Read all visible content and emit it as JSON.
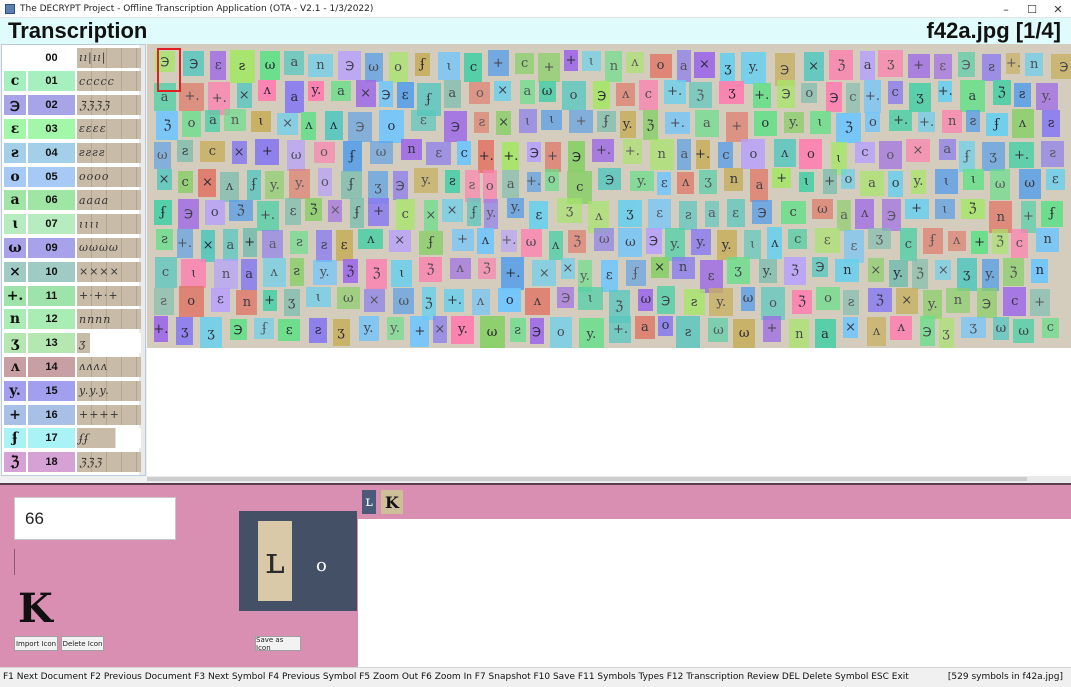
{
  "window": {
    "title": "The DECRYPT Project - Offline Transcription Application (OTA - V2.1 - 1/3/2022)",
    "minimize": "–",
    "maximize": "☐",
    "close": "✕"
  },
  "header": {
    "mode": "Transcription",
    "document": "f42a.jpg [1/4]"
  },
  "symbols": [
    {
      "glyph": "",
      "code": "00",
      "color": "#ffffff",
      "samples": "ıı|ıı|",
      "samples_style": ""
    },
    {
      "glyph": "c",
      "code": "01",
      "color": "#a6f0c0",
      "samples": "ccccc",
      "samples_style": ""
    },
    {
      "glyph": "℈",
      "code": "02",
      "color": "#a8a4e8",
      "samples": "ℨℨℨℨ",
      "samples_style": ""
    },
    {
      "glyph": "ε",
      "code": "03",
      "color": "#a2f7a8",
      "samples": "εεεε",
      "samples_style": ""
    },
    {
      "glyph": "ƨ",
      "code": "04",
      "color": "#a4cfe8",
      "samples": "ƨƨƨƨ",
      "samples_style": ""
    },
    {
      "glyph": "o",
      "code": "05",
      "color": "#a6c9f5",
      "samples": "oooo",
      "samples_style": ""
    },
    {
      "glyph": "a",
      "code": "06",
      "color": "#9fe6a4",
      "samples": "aaaa",
      "samples_style": ""
    },
    {
      "glyph": "ɩ",
      "code": "07",
      "color": "#b6ecc0",
      "samples": "ɩɩɩɩ",
      "samples_style": ""
    },
    {
      "glyph": "ω",
      "code": "09",
      "color": "#a7a2ea",
      "samples": "ωωωω",
      "samples_style": ""
    },
    {
      "glyph": "×",
      "code": "10",
      "color": "#9fcbc4",
      "samples": "××××",
      "samples_style": ""
    },
    {
      "glyph": "+.",
      "code": "11",
      "color": "#9ee3a9",
      "samples": "+·+·+",
      "samples_style": ""
    },
    {
      "glyph": "n",
      "code": "12",
      "color": "#a9edb5",
      "samples": "nnnn",
      "samples_style": ""
    },
    {
      "glyph": "ʒ",
      "code": "13",
      "color": "#b4e8b0",
      "samples": "ʒ",
      "samples_style": "tiny"
    },
    {
      "glyph": "ʌ",
      "code": "14",
      "color": "#c8a0a4",
      "samples": "ʌʌʌʌ",
      "samples_style": ""
    },
    {
      "glyph": "y.",
      "code": "15",
      "color": "#a2a0ee",
      "samples": "y.y.y.",
      "samples_style": ""
    },
    {
      "glyph": "+",
      "code": "16",
      "color": "#a8bfe6",
      "samples": "++++",
      "samples_style": ""
    },
    {
      "glyph": "ʄ",
      "code": "17",
      "color": "#a9f2f5",
      "samples": "ʄʄ",
      "samples_style": "short"
    },
    {
      "glyph": "ℨ",
      "code": "18",
      "color": "#d6a2d6",
      "samples": "ℨℨℨ",
      "samples_style": ""
    }
  ],
  "editor": {
    "symbol_value": "66",
    "icon_glyph": "K",
    "import_icon_label": "Import Icon",
    "delete_icon_label": "Delete Icon",
    "save_as_icon_label": "Save as Icon",
    "preview_glyph": "ʟ",
    "preview_neighbor": "o"
  },
  "transcription": {
    "glyph1": "ʟ",
    "glyph2": "K"
  },
  "status": {
    "shortcuts": "F1 Next Document F2 Previous Document F3 Next Symbol F4 Previous Symbol F5 Zoom Out F6 Zoom In F7 Snapshot F10 Save F11 Symbols Types F12 Transcription Review DEL Delete Symbol ESC Exit",
    "count": "[529 symbols in f42a.jpg]"
  },
  "manuscript_palette": [
    "#6ec6ff",
    "#8a7cf0",
    "#66e08a",
    "#b6a0ff",
    "#4fd0a8",
    "#ff7fb0",
    "#a7e66a",
    "#6ad0ee",
    "#9e6ae8",
    "#7fbfb0",
    "#e07a6a",
    "#58c8c0",
    "#c8b060",
    "#8ad06a",
    "#5aa0e8"
  ]
}
